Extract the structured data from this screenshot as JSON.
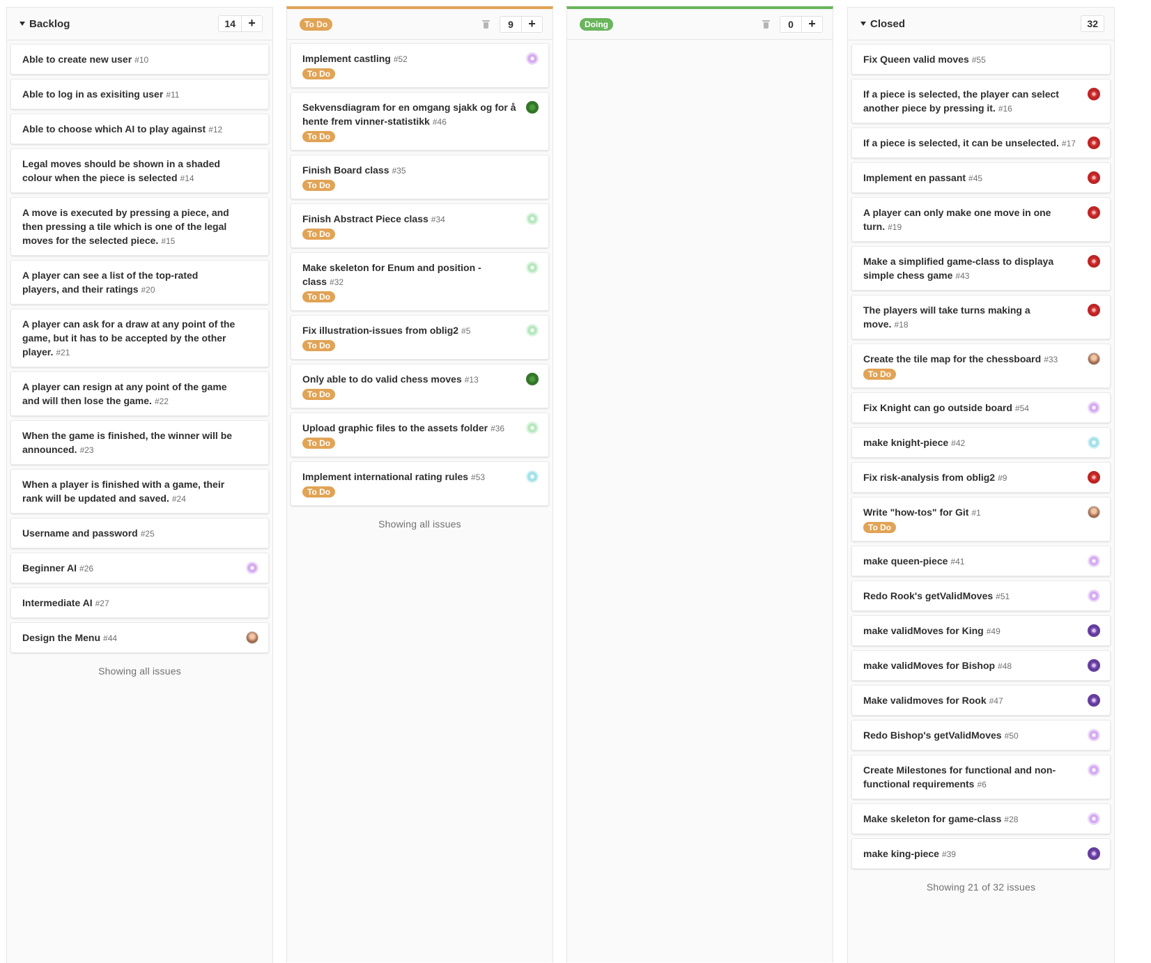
{
  "colors": {
    "todo_label": "#e1a355",
    "doing_label": "#69b55c",
    "todo_accent": "#e1a355",
    "doing_accent": "#69b55c"
  },
  "backlog": {
    "title": "Backlog",
    "count": "14",
    "add": "+",
    "footer": "Showing all issues",
    "cards": [
      {
        "title": "Able to create new user",
        "num": "#10"
      },
      {
        "title": "Able to log in as exisiting user",
        "num": "#11"
      },
      {
        "title": "Able to choose which AI to play against",
        "num": "#12"
      },
      {
        "title": "Legal moves should be shown in a shaded colour when the piece is selected",
        "num": "#14"
      },
      {
        "title": "A move is executed by pressing a piece, and then pressing a tile which is one of the legal moves for the selected piece.",
        "num": "#15"
      },
      {
        "title": "A player can see a list of the top-rated players, and their ratings",
        "num": "#20"
      },
      {
        "title": "A player can ask for a draw at any point of the game, but it has to be accepted by the other player.",
        "num": "#21"
      },
      {
        "title": "A player can resign at any point of the game and will then lose the game.",
        "num": "#22"
      },
      {
        "title": "When the game is finished, the winner will be announced.",
        "num": "#23"
      },
      {
        "title": "When a player is finished with a game, their rank will be updated and saved.",
        "num": "#24"
      },
      {
        "title": "Username and password",
        "num": "#25"
      },
      {
        "title": "Beginner AI",
        "num": "#26",
        "avatar": "lavender"
      },
      {
        "title": "Intermediate AI",
        "num": "#27"
      },
      {
        "title": "Design the Menu",
        "num": "#44",
        "avatar": "photo"
      }
    ]
  },
  "todo": {
    "title": "To Do",
    "count": "9",
    "add": "+",
    "footer": "Showing all issues",
    "cards": [
      {
        "title": "Implement castling",
        "num": "#52",
        "label": "To Do",
        "avatar": "lavender"
      },
      {
        "title": "Sekvensdiagram for en omgang sjakk og for å hente frem vinner-statistikk",
        "num": "#46",
        "label": "To Do",
        "avatar": "green"
      },
      {
        "title": "Finish Board class",
        "num": "#35",
        "label": "To Do"
      },
      {
        "title": "Finish Abstract Piece class",
        "num": "#34",
        "label": "To Do",
        "avatar": "mint"
      },
      {
        "title": "Make skeleton for Enum and position -class",
        "num": "#32",
        "label": "To Do",
        "avatar": "mint"
      },
      {
        "title": "Fix illustration-issues from oblig2",
        "num": "#5",
        "label": "To Do",
        "avatar": "mint"
      },
      {
        "title": "Only able to do valid chess moves",
        "num": "#13",
        "label": "To Do",
        "avatar": "green"
      },
      {
        "title": "Upload graphic files to the assets folder",
        "num": "#36",
        "label": "To Do",
        "avatar": "mint"
      },
      {
        "title": "Implement international rating rules",
        "num": "#53",
        "label": "To Do",
        "avatar": "cyan"
      }
    ]
  },
  "doing": {
    "title": "Doing",
    "count": "0",
    "add": "+"
  },
  "closed": {
    "title": "Closed",
    "count": "32",
    "footer": "Showing 21 of 32 issues",
    "cards": [
      {
        "title": "Fix Queen valid moves",
        "num": "#55"
      },
      {
        "title": "If a piece is selected, the player can select another piece by pressing it.",
        "num": "#16",
        "avatar": "red"
      },
      {
        "title": "If a piece is selected, it can be unselected.",
        "num": "#17",
        "avatar": "red"
      },
      {
        "title": "Implement en passant",
        "num": "#45",
        "avatar": "red"
      },
      {
        "title": "A player can only make one move in one turn.",
        "num": "#19",
        "avatar": "red"
      },
      {
        "title": "Make a simplified game-class to displaya simple chess game",
        "num": "#43",
        "avatar": "red"
      },
      {
        "title": "The players will take turns making a move.",
        "num": "#18",
        "avatar": "red"
      },
      {
        "title": "Create the tile map for the chessboard",
        "num": "#33",
        "label": "To Do",
        "avatar": "photo"
      },
      {
        "title": "Fix Knight can go outside board",
        "num": "#54",
        "avatar": "lavender"
      },
      {
        "title": "make knight-piece",
        "num": "#42",
        "avatar": "cyan"
      },
      {
        "title": "Fix risk-analysis from oblig2",
        "num": "#9",
        "avatar": "red"
      },
      {
        "title": "Write \"how-tos\" for Git",
        "num": "#1",
        "label": "To Do",
        "avatar": "photo"
      },
      {
        "title": "make queen-piece",
        "num": "#41",
        "avatar": "lavender"
      },
      {
        "title": "Redo Rook's getValidMoves",
        "num": "#51",
        "avatar": "lavender"
      },
      {
        "title": "make validMoves for King",
        "num": "#49",
        "avatar": "purple"
      },
      {
        "title": "make validMoves for Bishop",
        "num": "#48",
        "avatar": "purple"
      },
      {
        "title": "Make validmoves for Rook",
        "num": "#47",
        "avatar": "purple"
      },
      {
        "title": "Redo Bishop's getValidMoves",
        "num": "#50",
        "avatar": "lavender"
      },
      {
        "title": "Create Milestones for functional and non-functional requirements",
        "num": "#6",
        "avatar": "lavender"
      },
      {
        "title": "Make skeleton for game-class",
        "num": "#28",
        "avatar": "lavender"
      },
      {
        "title": "make king-piece",
        "num": "#39",
        "avatar": "purple"
      }
    ]
  }
}
